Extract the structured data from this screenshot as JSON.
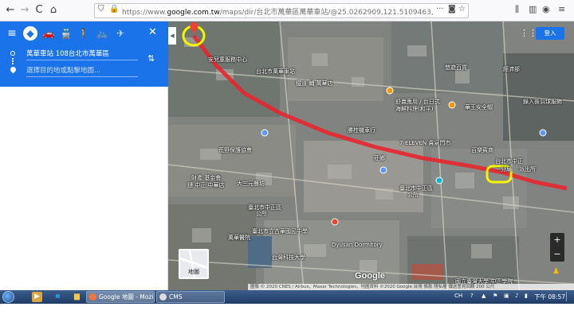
{
  "browser": {
    "url_prefix": "https://www.",
    "url_host": "google.com.tw",
    "url_path": "/maps/dir/台北市萬華區萬華車站/@25.0262909,121.5109463,697m/data=!3m1!1e3!4",
    "nav_back": "←",
    "nav_forward": "→",
    "nav_reload": "C",
    "nav_home": "⌂",
    "more_icon": "···"
  },
  "directions": {
    "menu_icon": "≡",
    "close_icon": "✕",
    "swap_icon": "⇅",
    "origin_value": "萬華車站 108台北市萬華區",
    "destination_placeholder": "選擇目的地或點擊地圖..."
  },
  "map": {
    "sign_in": "登入",
    "layer_label": "地圖",
    "logo": "Google",
    "attribution": "圖像 © 2020 CNES / Airbus，Maxar Technologies，地圖資料 ©2020 Google   台灣   條款   隱私權   傳送意見回饋   200 公尺",
    "labels": {
      "l1": "安兒童服務中心",
      "l2": "台北市萬華車站",
      "l3": "鐵道 輔 萬華店",
      "l4": "悠遊百貨",
      "l5": "經濟部",
      "l6": "舒賣應用 / 台日式",
      "l7": "海鮮料理(和平)",
      "l8": "華王安全帽",
      "l9": "錄入後羽球服飾",
      "l10": "勝桂機車行",
      "l11": "7-ELEVEN 貴泉門市",
      "l12": "百樂賓商",
      "l13": "莊鄉",
      "l14": "荒野保護協會",
      "l15": "財產 基金會",
      "l16": "鏈 中正 中華店",
      "l17": "大三元餐坊",
      "l18": "萬華醫院",
      "l19": "臺北市中正區",
      "l20": "公所",
      "l21": "臺北市中正區",
      "l22": "公所",
      "l23": "臺北市立古華國民中學",
      "l24": "台北市中正",
      "l25": "一分局",
      "l26": "派出所",
      "l27": "Dyusan Dormitory",
      "l28": "台灣科技大學",
      "l29": "國立臺灣大學 中正學院"
    }
  },
  "taskbar": {
    "tasks": [
      {
        "label": "Google 地圖 - Mozi..."
      },
      {
        "label": "CMS"
      }
    ],
    "tray_language": "CH",
    "clock": "下午 08:57"
  }
}
